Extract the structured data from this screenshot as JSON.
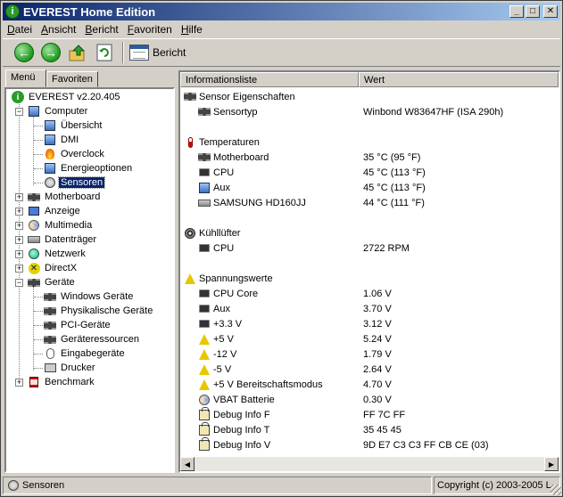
{
  "window": {
    "title": "EVEREST Home Edition"
  },
  "menubar": [
    "Datei",
    "Ansicht",
    "Bericht",
    "Favoriten",
    "Hilfe"
  ],
  "toolbar": {
    "report_label": "Bericht"
  },
  "left_tabs": [
    "Menü",
    "Favoriten"
  ],
  "tree": {
    "root": "EVEREST v2.20.405",
    "computer": "Computer",
    "computer_children": [
      "Übersicht",
      "DMI",
      "Overclock",
      "Energieoptionen",
      "Sensoren"
    ],
    "motherboard": "Motherboard",
    "anzeige": "Anzeige",
    "multimedia": "Multimedia",
    "datentraeger": "Datenträger",
    "netzwerk": "Netzwerk",
    "directx": "DirectX",
    "geraete": "Geräte",
    "geraete_children": [
      "Windows Geräte",
      "Physikalische Geräte",
      "PCI-Geräte",
      "Geräteressourcen",
      "Eingabegeräte",
      "Drucker"
    ],
    "benchmark": "Benchmark"
  },
  "table": {
    "col1": "Informationsliste",
    "col2": "Wert",
    "sensor_group": "Sensor Eigenschaften",
    "sensor_items": [
      {
        "name": "Sensortyp",
        "value": "Winbond W83647HF  (ISA 290h)"
      }
    ],
    "temp_group": "Temperaturen",
    "temp_items": [
      {
        "name": "Motherboard",
        "value": "35 °C  (95 °F)"
      },
      {
        "name": "CPU",
        "value": "45 °C  (113 °F)"
      },
      {
        "name": "Aux",
        "value": "45 °C  (113 °F)"
      },
      {
        "name": "SAMSUNG HD160JJ",
        "value": "44 °C  (111 °F)"
      }
    ],
    "fan_group": "Kühllüfter",
    "fan_items": [
      {
        "name": "CPU",
        "value": "2722 RPM"
      }
    ],
    "volt_group": "Spannungswerte",
    "volt_items": [
      {
        "name": "CPU Core",
        "value": "1.06 V"
      },
      {
        "name": "Aux",
        "value": "3.70 V"
      },
      {
        "name": "+3.3 V",
        "value": "3.12 V"
      },
      {
        "name": "+5 V",
        "value": "5.24 V"
      },
      {
        "name": "-12 V",
        "value": "1.79 V"
      },
      {
        "name": "-5 V",
        "value": "2.64 V"
      },
      {
        "name": "+5 V Bereitschaftsmodus",
        "value": "4.70 V"
      },
      {
        "name": "VBAT Batterie",
        "value": "0.30 V"
      },
      {
        "name": "Debug Info F",
        "value": "FF 7C FF"
      },
      {
        "name": "Debug Info T",
        "value": "35 45 45"
      },
      {
        "name": "Debug Info V",
        "value": "9D E7 C3 C3 FF CB CE (03)"
      }
    ]
  },
  "statusbar": {
    "left": "Sensoren",
    "right": "Copyright (c) 2003-2005 L"
  }
}
